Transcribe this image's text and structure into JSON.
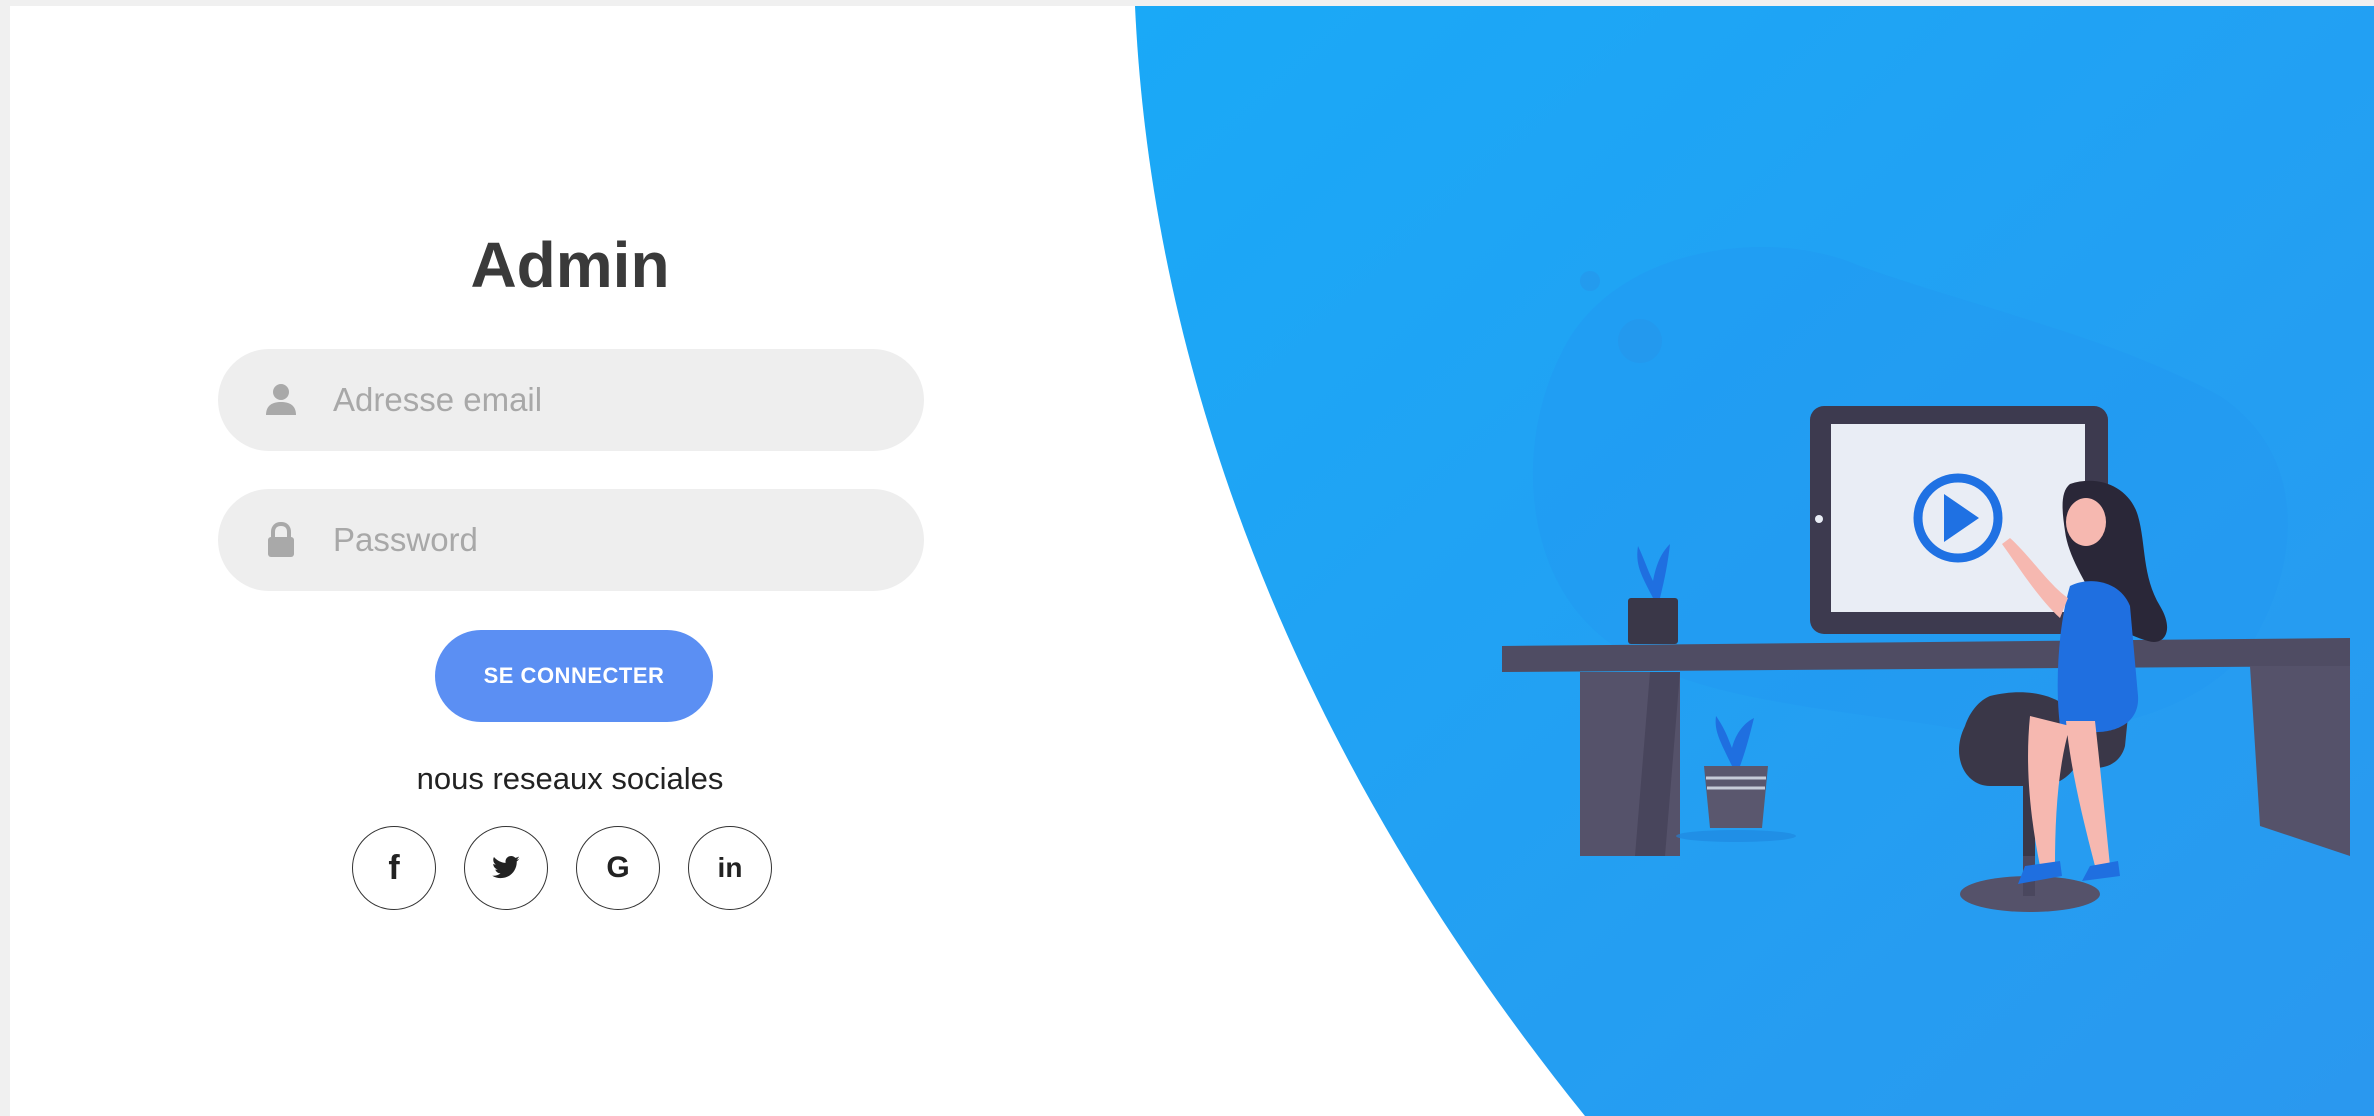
{
  "login": {
    "title": "Admin",
    "email": {
      "placeholder": "Adresse email",
      "value": "",
      "icon": "user-icon"
    },
    "password": {
      "placeholder": "Password",
      "value": "",
      "icon": "lock-icon"
    },
    "submit_label": "SE CONNECTER",
    "social_caption": "nous reseaux sociales",
    "social": [
      {
        "name": "facebook",
        "icon": "facebook-icon",
        "label": "f"
      },
      {
        "name": "twitter",
        "icon": "twitter-icon",
        "label": ""
      },
      {
        "name": "google",
        "icon": "google-icon",
        "label": "G"
      },
      {
        "name": "linkedin",
        "icon": "linkedin-icon",
        "label": "in"
      }
    ]
  },
  "colors": {
    "accent": "#5b8ff3",
    "panel_blue": "#1aa5f6",
    "panel_blue_light": "#2ba0f2",
    "input_bg": "#eeeeee",
    "title": "#3a3a3a"
  },
  "illustration": {
    "icon": "woman-at-desk-with-monitor-illustration",
    "screen_icon": "play-icon"
  }
}
